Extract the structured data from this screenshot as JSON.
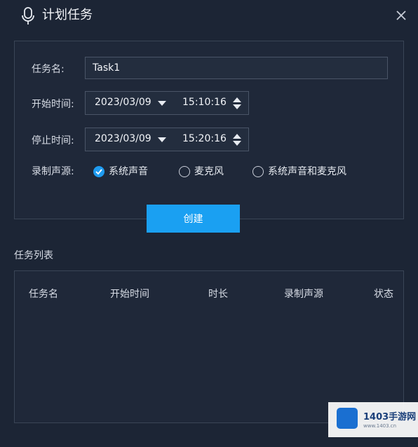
{
  "window": {
    "title": "计划任务"
  },
  "form": {
    "task_name_label": "任务名:",
    "task_name_value": "Task1",
    "start_label": "开始时间:",
    "start_date": "2023/03/09",
    "start_time": "15:10:16",
    "stop_label": "停止时间:",
    "stop_date": "2023/03/09",
    "stop_time": "15:20:16",
    "source_label": "录制声源:",
    "sources": [
      {
        "label": "系统声音",
        "checked": true
      },
      {
        "label": "麦克风",
        "checked": false
      },
      {
        "label": "系统声音和麦克风",
        "checked": false
      }
    ],
    "create_label": "创建"
  },
  "task_list": {
    "title": "任务列表",
    "columns": [
      "任务名",
      "开始时间",
      "时长",
      "录制声源",
      "状态"
    ]
  },
  "watermark": {
    "text": "1403手游网",
    "sub": "www.1403.cn"
  },
  "colors": {
    "background": "#1c2535",
    "accent": "#1aa0f2",
    "border": "#3a4556"
  }
}
